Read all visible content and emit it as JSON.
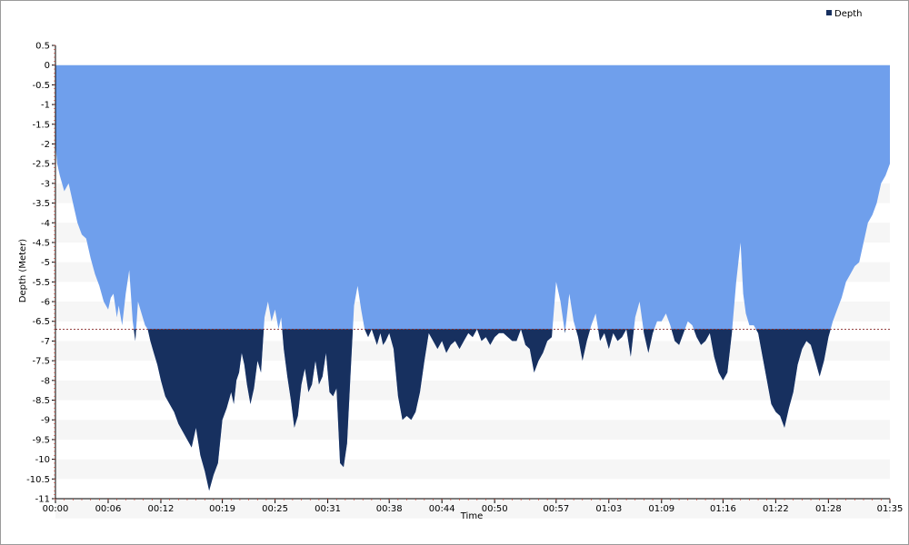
{
  "chart_data": {
    "type": "area",
    "title": "",
    "xlabel": "Time",
    "ylabel": "Depth (Meter)",
    "legend": {
      "position": "top-right",
      "entries": [
        "Depth"
      ]
    },
    "grid": "horizontal alternating bands",
    "colors": {
      "area": "#6f9fec",
      "below_reference": "#17305f",
      "band": "#f6f6f6",
      "reference_line": "#8a2b2b"
    },
    "ylim": [
      -11,
      0.5
    ],
    "xlim_minutes": [
      0,
      95
    ],
    "y_ticks": [
      "0.5",
      "0",
      "-0.5",
      "-1",
      "-1.5",
      "-2",
      "-2.5",
      "-3",
      "-3.5",
      "-4",
      "-4.5",
      "-5",
      "-5.5",
      "-6",
      "-6.5",
      "-7",
      "-7.5",
      "-8",
      "-8.5",
      "-9",
      "-9.5",
      "-10",
      "-10.5",
      "-11"
    ],
    "x_ticks": [
      "00:00",
      "00:06",
      "00:12",
      "00:19",
      "00:25",
      "00:31",
      "00:38",
      "00:44",
      "00:50",
      "00:57",
      "01:03",
      "01:09",
      "01:16",
      "01:22",
      "01:28",
      "01:35"
    ],
    "reference_depth": -6.7,
    "series": [
      {
        "name": "Depth",
        "x_minutes": [
          0,
          0.2,
          0.5,
          1,
          1.5,
          2,
          2.5,
          3,
          3.5,
          4,
          4.5,
          5,
          5.5,
          6,
          6.3,
          6.6,
          7,
          7.2,
          7.6,
          8,
          8.4,
          8.8,
          9.1,
          9.4,
          9.8,
          10.2,
          10.5,
          10.8,
          11.2,
          11.6,
          12,
          12.5,
          13,
          13.5,
          14,
          14.5,
          15,
          15.5,
          16,
          16.5,
          17,
          17.5,
          18,
          18.5,
          19,
          19.5,
          20,
          20.3,
          20.6,
          20.9,
          21.2,
          21.5,
          21.8,
          22.2,
          22.6,
          23,
          23.4,
          23.8,
          24.2,
          24.6,
          25,
          25.4,
          25.7,
          26,
          26.4,
          26.8,
          27.2,
          27.6,
          28,
          28.4,
          28.8,
          29.2,
          29.6,
          30,
          30.4,
          30.8,
          31.2,
          31.6,
          32,
          32.4,
          32.8,
          33.2,
          33.6,
          34,
          34.4,
          34.8,
          35.2,
          35.6,
          36,
          36.3,
          36.6,
          37,
          37.3,
          37.6,
          38,
          38.5,
          39,
          39.5,
          40,
          40.5,
          41,
          41.5,
          42,
          42.5,
          43,
          43.5,
          44,
          44.5,
          45,
          45.5,
          46,
          46.5,
          47,
          47.5,
          48,
          48.5,
          49,
          49.5,
          50,
          50.5,
          51,
          51.5,
          52,
          52.5,
          53,
          53.5,
          54,
          54.5,
          55,
          55.5,
          56,
          56.5,
          57,
          57.5,
          58,
          58.5,
          59,
          59.5,
          60,
          60.5,
          61,
          61.5,
          62,
          62.5,
          63,
          63.5,
          64,
          64.5,
          65,
          65.5,
          66,
          66.5,
          67,
          67.5,
          68,
          68.5,
          69,
          69.5,
          70,
          70.5,
          71,
          71.5,
          72,
          72.5,
          73,
          73.5,
          74,
          74.5,
          75,
          75.5,
          76,
          76.5,
          77,
          77.5,
          78,
          78.3,
          78.6,
          79,
          79.5,
          80,
          80.5,
          81,
          81.5,
          82,
          82.5,
          83,
          83.5,
          84,
          84.5,
          85,
          85.5,
          86,
          86.5,
          87,
          87.5,
          88,
          88.5,
          89,
          89.5,
          90,
          90.5,
          91,
          91.5,
          92,
          92.5,
          93,
          93.5,
          94,
          94.5,
          95
        ],
        "values": [
          -2.0,
          -2.5,
          -2.8,
          -3.2,
          -3.0,
          -3.5,
          -4.0,
          -4.3,
          -4.4,
          -4.9,
          -5.3,
          -5.6,
          -6.0,
          -6.2,
          -5.9,
          -5.8,
          -6.4,
          -6.1,
          -6.6,
          -5.8,
          -5.2,
          -6.5,
          -7.0,
          -6.0,
          -6.3,
          -6.6,
          -6.7,
          -7.0,
          -7.3,
          -7.6,
          -8.0,
          -8.4,
          -8.6,
          -8.8,
          -9.1,
          -9.3,
          -9.5,
          -9.7,
          -9.2,
          -9.9,
          -10.3,
          -10.8,
          -10.4,
          -10.1,
          -9.0,
          -8.7,
          -8.3,
          -8.6,
          -8.0,
          -7.8,
          -7.3,
          -7.6,
          -8.1,
          -8.6,
          -8.2,
          -7.5,
          -7.8,
          -6.4,
          -6.0,
          -6.5,
          -6.2,
          -6.7,
          -6.4,
          -7.2,
          -7.9,
          -8.5,
          -9.2,
          -8.9,
          -8.1,
          -7.7,
          -8.3,
          -8.1,
          -7.5,
          -8.1,
          -7.9,
          -7.3,
          -8.3,
          -8.4,
          -8.2,
          -10.1,
          -10.2,
          -9.6,
          -7.8,
          -6.1,
          -5.6,
          -6.2,
          -6.7,
          -6.9,
          -6.7,
          -6.9,
          -7.1,
          -6.8,
          -7.1,
          -7.0,
          -6.8,
          -7.2,
          -8.4,
          -9.0,
          -8.9,
          -9.0,
          -8.8,
          -8.3,
          -7.5,
          -6.8,
          -7.0,
          -7.2,
          -7.0,
          -7.3,
          -7.1,
          -7.0,
          -7.2,
          -7.0,
          -6.8,
          -6.9,
          -6.7,
          -7.0,
          -6.9,
          -7.1,
          -6.9,
          -6.8,
          -6.8,
          -6.9,
          -7.0,
          -7.0,
          -6.7,
          -7.1,
          -7.2,
          -7.8,
          -7.5,
          -7.3,
          -7.0,
          -6.9,
          -5.5,
          -6.0,
          -6.8,
          -5.8,
          -6.5,
          -6.9,
          -7.5,
          -7.0,
          -6.6,
          -6.3,
          -7.0,
          -6.8,
          -7.2,
          -6.8,
          -7.0,
          -6.9,
          -6.7,
          -7.4,
          -6.4,
          -6.0,
          -6.8,
          -7.3,
          -6.8,
          -6.5,
          -6.5,
          -6.3,
          -6.6,
          -7.0,
          -7.1,
          -6.8,
          -6.5,
          -6.6,
          -6.9,
          -7.1,
          -7.0,
          -6.8,
          -7.4,
          -7.8,
          -8.0,
          -7.8,
          -6.8,
          -5.5,
          -4.5,
          -5.8,
          -6.3,
          -6.6,
          -6.6,
          -6.8,
          -7.4,
          -8.0,
          -8.6,
          -8.8,
          -8.9,
          -9.2,
          -8.7,
          -8.3,
          -7.6,
          -7.2,
          -7.0,
          -7.1,
          -7.5,
          -7.9,
          -7.5,
          -6.9,
          -6.5,
          -6.2,
          -5.9,
          -5.5,
          -5.3,
          -5.1,
          -5.0,
          -4.5,
          -4.0,
          -3.8,
          -3.5,
          -3.0,
          -2.8,
          -2.5,
          -2.0
        ]
      }
    ]
  }
}
